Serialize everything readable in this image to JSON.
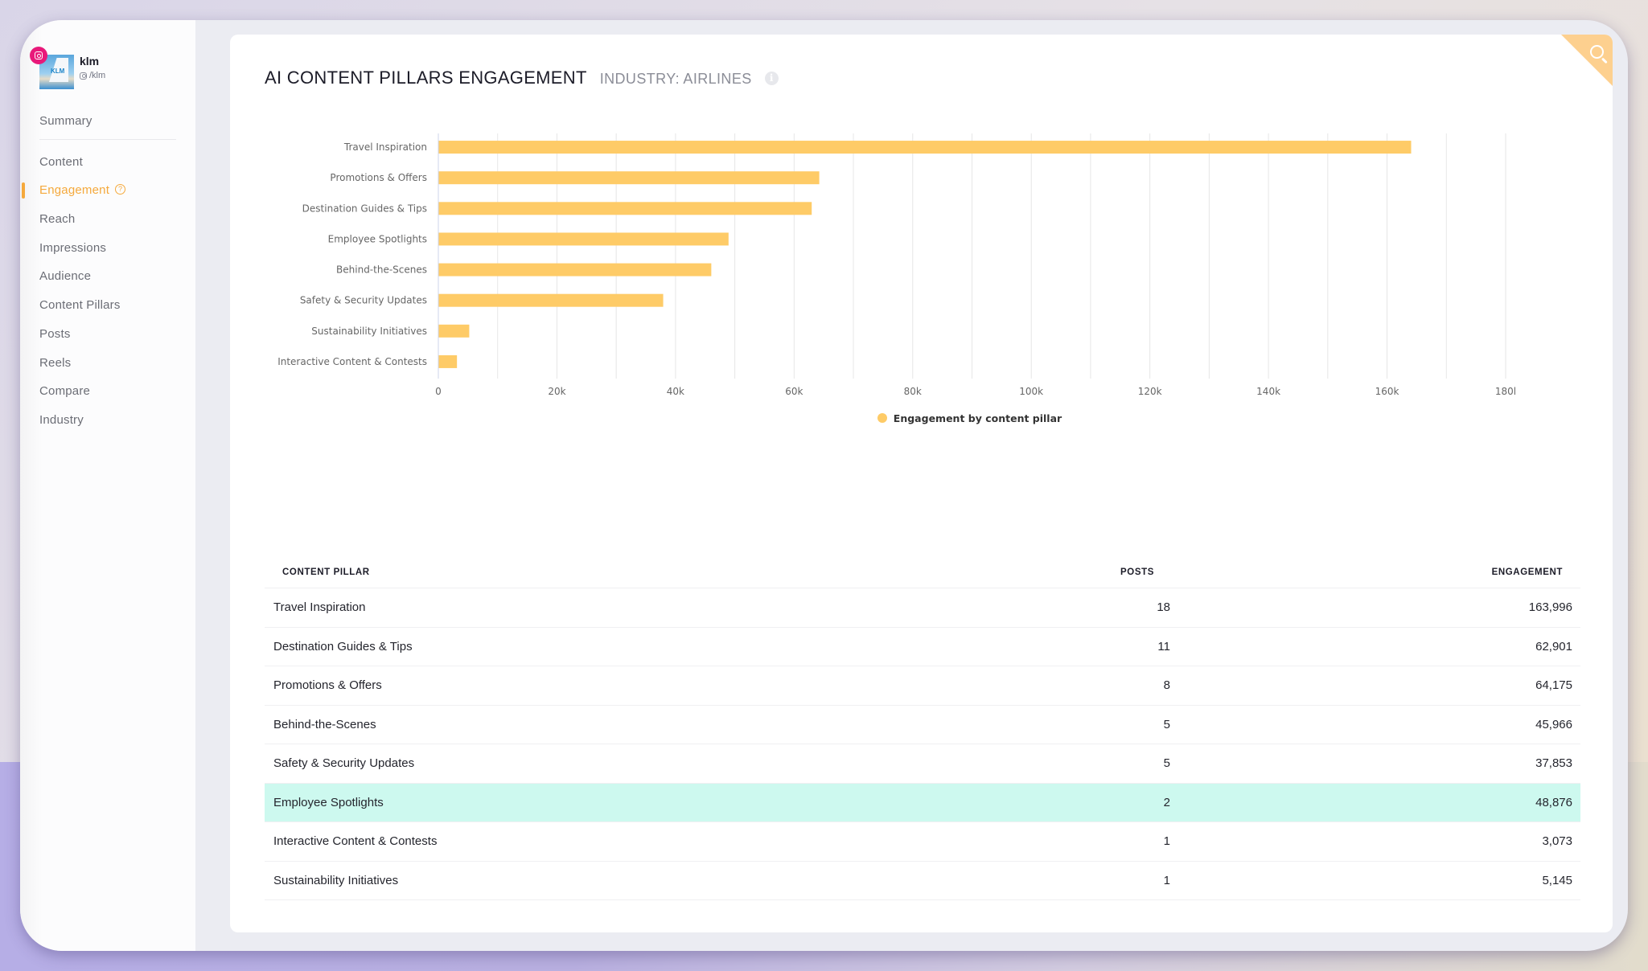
{
  "profile": {
    "name": "klm",
    "handle": "/klm",
    "platform": "instagram",
    "platform_color": "#e8197a"
  },
  "sidebar": {
    "summary": "Summary",
    "items": [
      {
        "label": "Content",
        "active": false
      },
      {
        "label": "Engagement",
        "active": true,
        "help": "?"
      },
      {
        "label": "Reach",
        "active": false
      },
      {
        "label": "Impressions",
        "active": false
      },
      {
        "label": "Audience",
        "active": false
      },
      {
        "label": "Content Pillars",
        "active": false
      },
      {
        "label": "Posts",
        "active": false
      },
      {
        "label": "Reels",
        "active": false
      },
      {
        "label": "Compare",
        "active": false
      },
      {
        "label": "Industry",
        "active": false
      }
    ],
    "accent_color": "#f5a93c"
  },
  "card": {
    "title": "AI CONTENT PILLARS ENGAGEMENT",
    "subtitle": "INDUSTRY: AIRLINES",
    "info_icon": "i",
    "corner_icon": "search-icon"
  },
  "chart_data": {
    "type": "bar",
    "orientation": "horizontal",
    "categories": [
      "Travel Inspiration",
      "Promotions & Offers",
      "Destination Guides & Tips",
      "Employee Spotlights",
      "Behind-the-Scenes",
      "Safety & Security Updates",
      "Sustainability Initiatives",
      "Interactive Content & Contests"
    ],
    "series": [
      {
        "name": "Engagement by content pillar",
        "color": "#fecb67",
        "values": [
          163996,
          64175,
          62901,
          48876,
          45966,
          37853,
          5145,
          3073
        ]
      }
    ],
    "xlim": [
      0,
      180000
    ],
    "x_ticks": [
      0,
      20000,
      40000,
      60000,
      80000,
      100000,
      120000,
      140000,
      160000,
      180000
    ],
    "x_tick_labels": [
      "0",
      "20k",
      "40k",
      "60k",
      "80k",
      "100k",
      "120k",
      "140k",
      "160k",
      "180l"
    ],
    "grid_step": 10000,
    "grid": true,
    "legend": "bottom-center",
    "title": "",
    "xlabel": "",
    "ylabel": ""
  },
  "table": {
    "headers": {
      "pillar": "CONTENT PILLAR",
      "posts": "POSTS",
      "engagement": "ENGAGEMENT"
    },
    "rows": [
      {
        "pillar": "Travel Inspiration",
        "posts": "18",
        "engagement": "163,996",
        "highlight": false
      },
      {
        "pillar": "Destination Guides & Tips",
        "posts": "11",
        "engagement": "62,901",
        "highlight": false
      },
      {
        "pillar": "Promotions & Offers",
        "posts": "8",
        "engagement": "64,175",
        "highlight": false
      },
      {
        "pillar": "Behind-the-Scenes",
        "posts": "5",
        "engagement": "45,966",
        "highlight": false
      },
      {
        "pillar": "Safety & Security Updates",
        "posts": "5",
        "engagement": "37,853",
        "highlight": false
      },
      {
        "pillar": "Employee Spotlights",
        "posts": "2",
        "engagement": "48,876",
        "highlight": true
      },
      {
        "pillar": "Interactive Content & Contests",
        "posts": "1",
        "engagement": "3,073",
        "highlight": false
      },
      {
        "pillar": "Sustainability Initiatives",
        "posts": "1",
        "engagement": "5,145",
        "highlight": false
      }
    ],
    "highlight_color": "#cdf9ef"
  }
}
